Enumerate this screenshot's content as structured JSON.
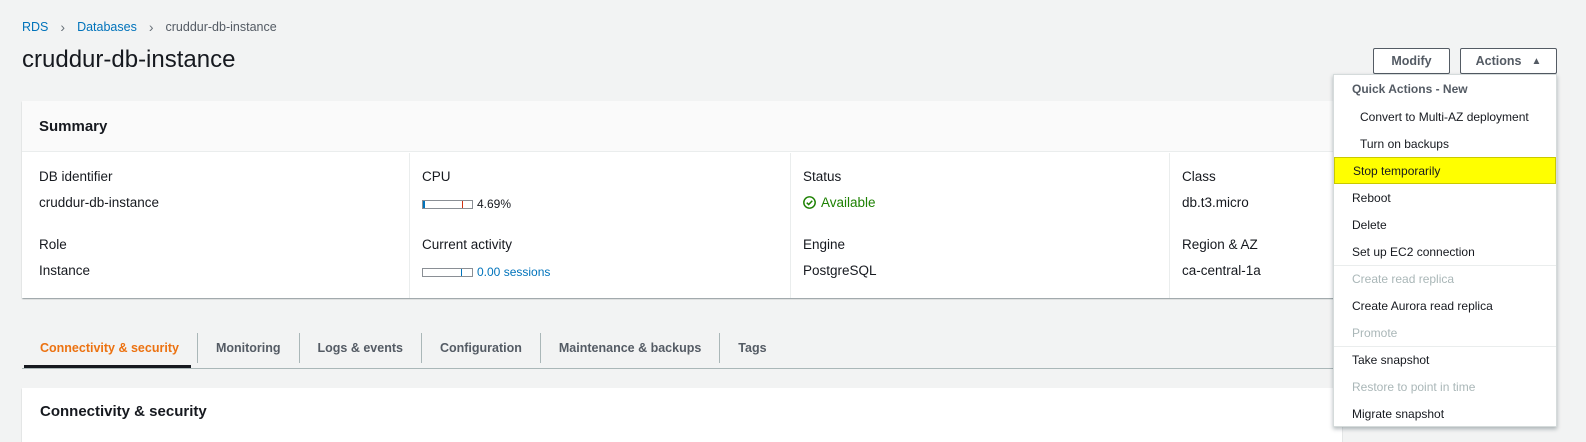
{
  "breadcrumb": [
    {
      "label": "RDS"
    },
    {
      "label": "Databases"
    },
    {
      "label": "cruddur-db-instance"
    }
  ],
  "page_title": "cruddur-db-instance",
  "buttons": {
    "modify": "Modify",
    "actions": "Actions"
  },
  "summary": {
    "title": "Summary",
    "db_identifier_label": "DB identifier",
    "db_identifier": "cruddur-db-instance",
    "cpu_label": "CPU",
    "cpu_value": "4.69%",
    "status_label": "Status",
    "status_value": "Available",
    "class_label": "Class",
    "class_value": "db.t3.micro",
    "role_label": "Role",
    "role_value": "Instance",
    "activity_label": "Current activity",
    "activity_value": "0.00 sessions",
    "engine_label": "Engine",
    "engine_value": "PostgreSQL",
    "region_label": "Region & AZ",
    "region_value": "ca-central-1a"
  },
  "tabs": [
    {
      "label": "Connectivity & security",
      "active": true
    },
    {
      "label": "Monitoring"
    },
    {
      "label": "Logs & events"
    },
    {
      "label": "Configuration"
    },
    {
      "label": "Maintenance & backups"
    },
    {
      "label": "Tags"
    }
  ],
  "section_title": "Connectivity & security",
  "actions_menu": {
    "group_label": "Quick Actions - New",
    "items": [
      {
        "label": "Convert to Multi-AZ deployment"
      },
      {
        "label": "Turn on backups"
      },
      {
        "label": "Stop temporarily"
      },
      {
        "label": "Reboot"
      },
      {
        "label": "Delete"
      },
      {
        "label": "Set up EC2 connection"
      },
      {
        "label": "Create read replica"
      },
      {
        "label": "Create Aurora read replica"
      },
      {
        "label": "Promote"
      },
      {
        "label": "Take snapshot"
      },
      {
        "label": "Restore to point in time"
      },
      {
        "label": "Migrate snapshot"
      }
    ]
  },
  "colors": {
    "link": "#0073bb",
    "active_tab": "#ec7211",
    "status_ok": "#1d8102",
    "highlight": "#ffff00"
  }
}
